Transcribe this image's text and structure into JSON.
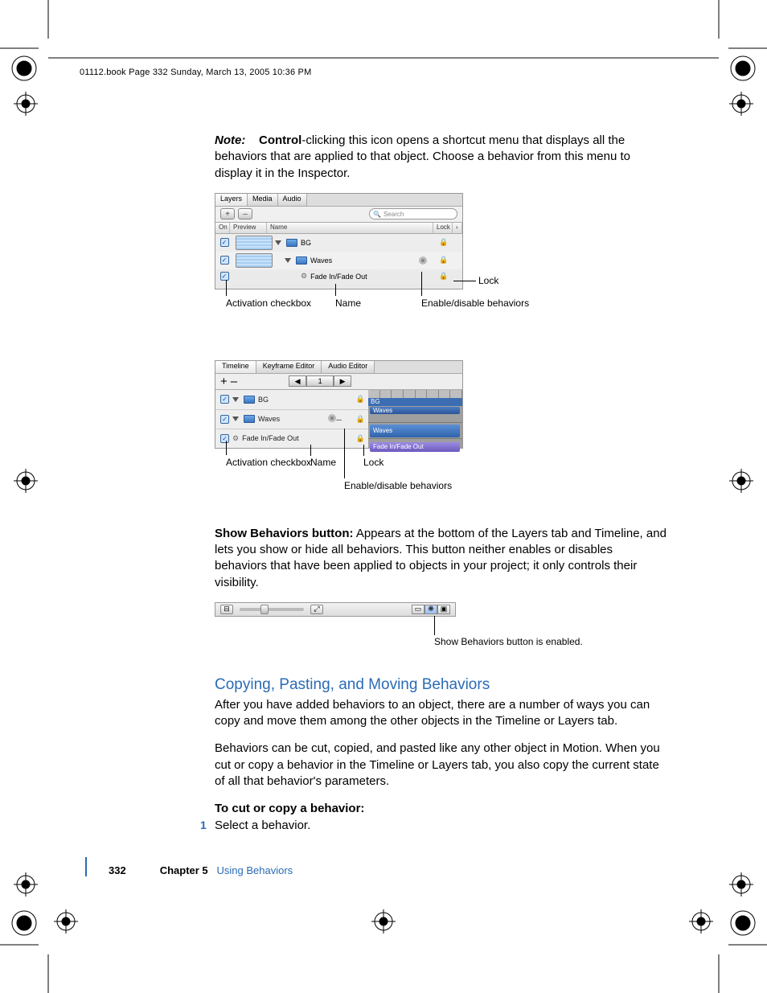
{
  "header_line": "01112.book  Page 332  Sunday, March 13, 2005  10:36 PM",
  "note": {
    "prefix": "Note:",
    "bold_inline": "Control",
    "text_after": "-clicking this icon opens a shortcut menu that displays all the behaviors that are applied to that object. Choose a behavior from this menu to display it in the Inspector."
  },
  "fig1": {
    "tabs": {
      "layers": "Layers",
      "media": "Media",
      "audio": "Audio"
    },
    "plus": "+",
    "minus": "–",
    "search_placeholder": "Search",
    "cols": {
      "on": "On",
      "preview": "Preview",
      "name": "Name",
      "lock": "Lock"
    },
    "rows": {
      "bg": "BG",
      "waves": "Waves",
      "fade": "Fade In/Fade Out"
    },
    "callouts": {
      "activation": "Activation checkbox",
      "name": "Name",
      "enable": "Enable/disable behaviors",
      "lock": "Lock"
    }
  },
  "fig2": {
    "tabs": {
      "timeline": "Timeline",
      "keyframe": "Keyframe Editor",
      "audio": "Audio Editor"
    },
    "plus": "+",
    "minus": "–",
    "pager": {
      "prev": "◀",
      "page": "1",
      "next": "▶"
    },
    "rows": {
      "bg": "BG",
      "waves": "Waves",
      "fade": "Fade In/Fade Out"
    },
    "tracks": {
      "bg_head": "BG",
      "waves1": "Waves",
      "waves2": "Waves",
      "fade": "Fade In/Fade Out"
    },
    "callouts": {
      "activation": "Activation checkbox",
      "name": "Name",
      "lock": "Lock",
      "enable": "Enable/disable behaviors"
    }
  },
  "show_behaviors_para": {
    "bold": "Show Behaviors button:",
    "text": " Appears at the bottom of the Layers tab and Timeline, and lets you show or hide all behaviors. This button neither enables or disables behaviors that have been applied to objects in your project; it only controls their visibility."
  },
  "fig3_caption": "Show Behaviors button is enabled.",
  "heading_copy": "Copying, Pasting, and Moving Behaviors",
  "para_copy": "After you have added behaviors to an object, there are a number of ways you can copy and move them among the other objects in the Timeline or Layers tab.",
  "para_cut": "Behaviors can be cut, copied, and pasted like any other object in Motion. When you cut or copy a behavior in the Timeline or Layers tab, you also copy the current state of all that behavior's parameters.",
  "howto_head": "To cut or copy a behavior:",
  "step1_num": "1",
  "step1_text": "Select a behavior.",
  "footer": {
    "page": "332",
    "chapter": "Chapter 5",
    "title": "Using Behaviors"
  }
}
